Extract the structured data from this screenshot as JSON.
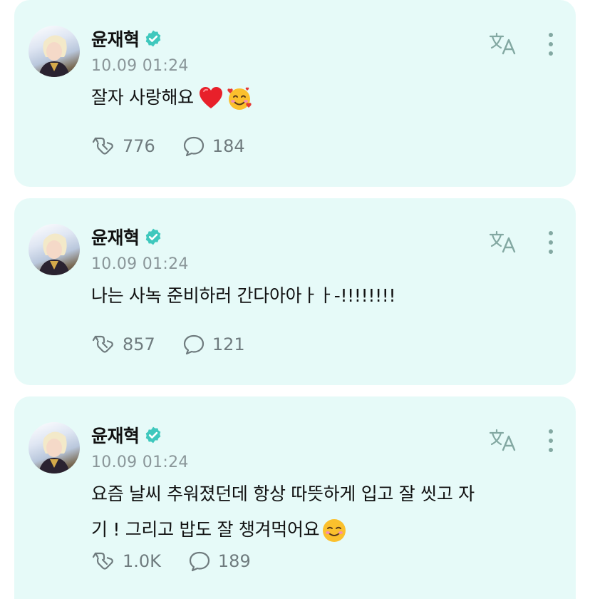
{
  "colors": {
    "card_bg": "#e6faf8",
    "badge": "#3fc8bd",
    "icon": "#83a8a2"
  },
  "posts": [
    {
      "author": "윤재혁",
      "time": "10.09 01:24",
      "text": "잘자 사랑해요",
      "emojis": [
        "heart-emoji",
        "smiling-face-with-hearts-emoji"
      ],
      "reposts": "776",
      "comments": "184"
    },
    {
      "author": "윤재혁",
      "time": "10.09 01:24",
      "text": "나는 사녹 준비하러 간다아아ㅏㅏ-!!!!!!!!",
      "emojis": [],
      "reposts": "857",
      "comments": "121"
    },
    {
      "author": "윤재혁",
      "time": "10.09 01:24",
      "text_line1": "요즘 날씨 추워졌던데 항상 따뜻하게 입고 잘 씻고 자",
      "text_line2": "기 ! 그리고 밥도 잘 챙겨먹어요",
      "emojis": [
        "smiling-face-emoji"
      ],
      "reposts": "1.0K",
      "comments": "189"
    }
  ]
}
